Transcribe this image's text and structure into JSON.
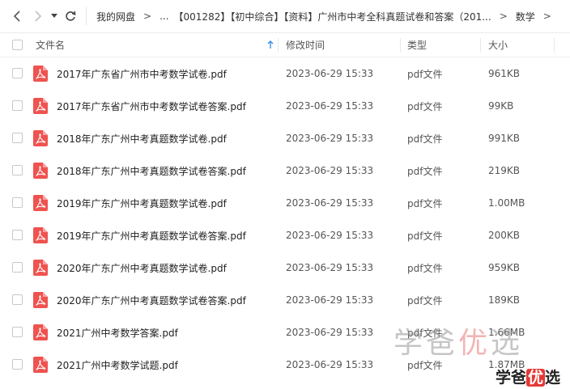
{
  "breadcrumb": [
    "我的网盘",
    "...",
    "【001282】【初中综合】【资料】广州市中考全科真题试卷和答案（201...",
    "数学"
  ],
  "columns": {
    "name": "文件名",
    "time": "修改时间",
    "type": "类型",
    "size": "大小"
  },
  "files": [
    {
      "name": "2017年广东省广州市中考数学试卷.pdf",
      "time": "2023-06-29 15:33",
      "type": "pdf文件",
      "size": "961KB"
    },
    {
      "name": "2017年广东省广州市中考数学试卷答案.pdf",
      "time": "2023-06-29 15:33",
      "type": "pdf文件",
      "size": "99KB"
    },
    {
      "name": "2018年广东广州中考真题数学试卷.pdf",
      "time": "2023-06-29 15:33",
      "type": "pdf文件",
      "size": "991KB"
    },
    {
      "name": "2018年广东广州中考真题数学试卷答案.pdf",
      "time": "2023-06-29 15:33",
      "type": "pdf文件",
      "size": "219KB"
    },
    {
      "name": "2019年广东广州中考真题数学试卷.pdf",
      "time": "2023-06-29 15:33",
      "type": "pdf文件",
      "size": "1.00MB"
    },
    {
      "name": "2019年广东广州中考真题数学试卷答案.pdf",
      "time": "2023-06-29 15:33",
      "type": "pdf文件",
      "size": "200KB"
    },
    {
      "name": "2020年广东广州中考真题数学试卷.pdf",
      "time": "2023-06-29 15:33",
      "type": "pdf文件",
      "size": "959KB"
    },
    {
      "name": "2020年广东广州中考真题数学试卷答案.pdf",
      "time": "2023-06-29 15:33",
      "type": "pdf文件",
      "size": "189KB"
    },
    {
      "name": "2021广州中考数学答案.pdf",
      "time": "2023-06-29 15:33",
      "type": "pdf文件",
      "size": "1.66MB"
    },
    {
      "name": "2021广州中考数学试题.pdf",
      "time": "2023-06-29 15:33",
      "type": "pdf文件",
      "size": "1.87MB"
    }
  ],
  "watermark": {
    "big": [
      "学",
      "爸",
      "优",
      "选"
    ],
    "small": [
      "学爸",
      "优",
      "选"
    ]
  },
  "colors": {
    "pdf_icon": "#ef5350",
    "sort_arrow": "#3b8beb"
  },
  "icons": [
    "back-icon",
    "forward-icon",
    "dropdown-icon",
    "refresh-icon",
    "sort-up-icon",
    "pdf-file-icon"
  ]
}
